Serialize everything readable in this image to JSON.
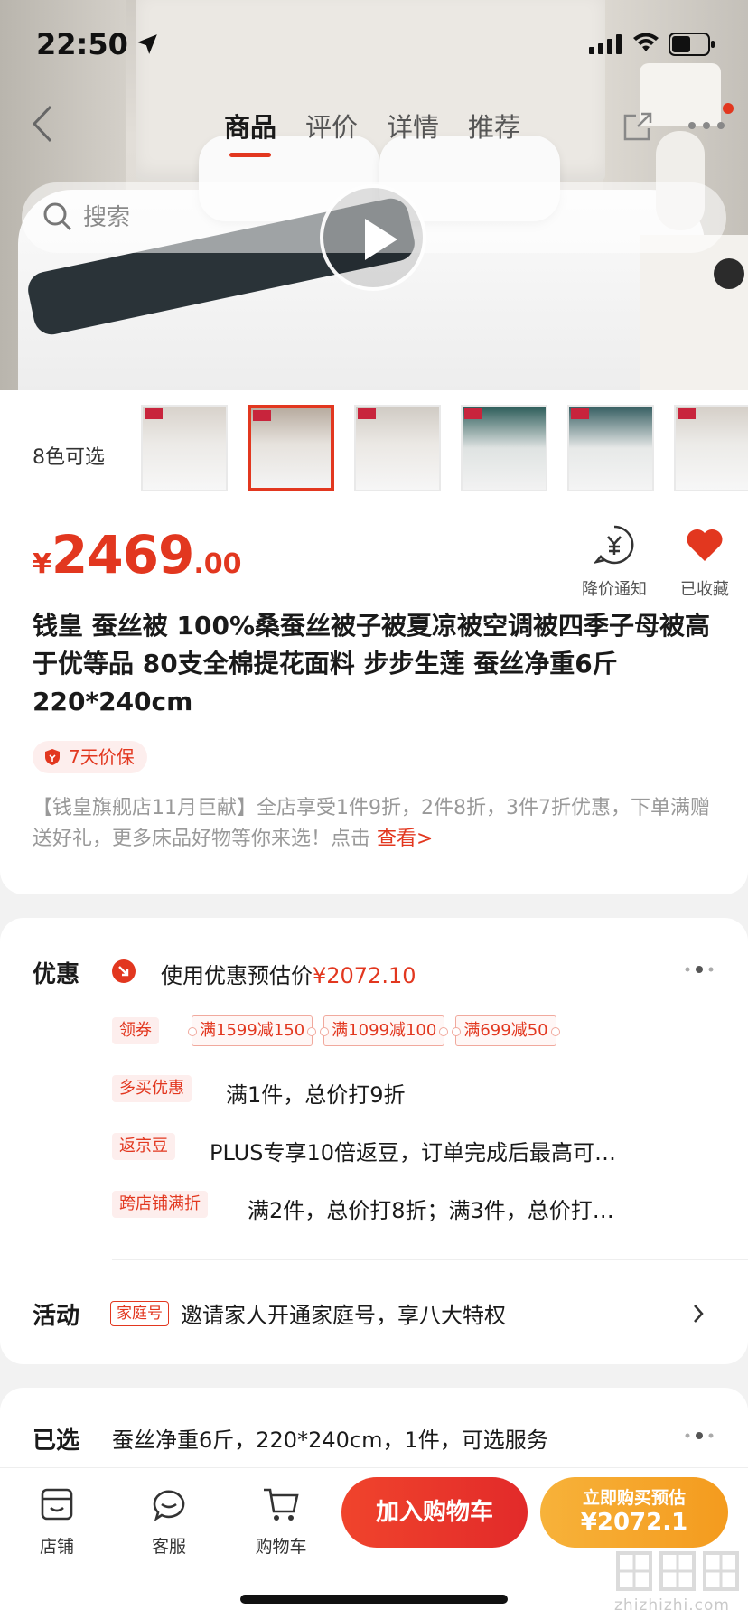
{
  "status_bar": {
    "time": "22:50"
  },
  "nav": {
    "tabs": [
      {
        "label": "商品",
        "active": true
      },
      {
        "label": "评价",
        "active": false
      },
      {
        "label": "详情",
        "active": false
      },
      {
        "label": "推荐",
        "active": false
      }
    ],
    "search_placeholder": "搜索"
  },
  "variants": {
    "label": "8色可选",
    "selected_index": 1,
    "thumb_count": 6
  },
  "price": {
    "symbol": "¥",
    "integer": "2469",
    "decimal": ".00"
  },
  "actions": {
    "notify_label": "降价通知",
    "favorite_label": "已收藏"
  },
  "product": {
    "title": "钱皇 蚕丝被 100%桑蚕丝被子被夏凉被空调被四季子母被高于优等品 80支全棉提花面料 步步生莲 蚕丝净重6斤 220*240cm",
    "guarantee": "7天价保",
    "promo_text": "【钱皇旗舰店11月巨献】全店享受1件9折，2件8折，3件7折优惠，下单满赠送好礼，更多床品好物等你来选！点击 ",
    "promo_link": "查看>"
  },
  "offers": {
    "label": "优惠",
    "estimate_text": "使用优惠预估价",
    "estimate_price": "¥2072.10",
    "coupon_tag": "领券",
    "coupons": [
      "满1599减150",
      "满1099减100",
      "满699减50"
    ],
    "multi_tag": "多买优惠",
    "multi_text": "满1件，总价打9折",
    "bean_tag": "返京豆",
    "bean_text": "PLUS专享10倍返豆，订单完成后最高可…",
    "cross_tag": "跨店铺满折",
    "cross_text": "满2件，总价打8折；满3件，总价打…"
  },
  "activity": {
    "label": "活动",
    "tag": "家庭号",
    "text": "邀请家人开通家庭号，享八大特权"
  },
  "selected": {
    "label": "已选",
    "text": "蚕丝净重6斤，220*240cm，1件，可选服务"
  },
  "bottom_bar": {
    "store": "店铺",
    "service": "客服",
    "cart": "购物车",
    "add_to_cart": "加入购物车",
    "buy_line1": "立即购买预估",
    "buy_line2": "¥2072.1"
  },
  "watermark": {
    "url": "zhizhizhi.com"
  },
  "colors": {
    "accent": "#e2371f",
    "buy": "#f5a623"
  }
}
